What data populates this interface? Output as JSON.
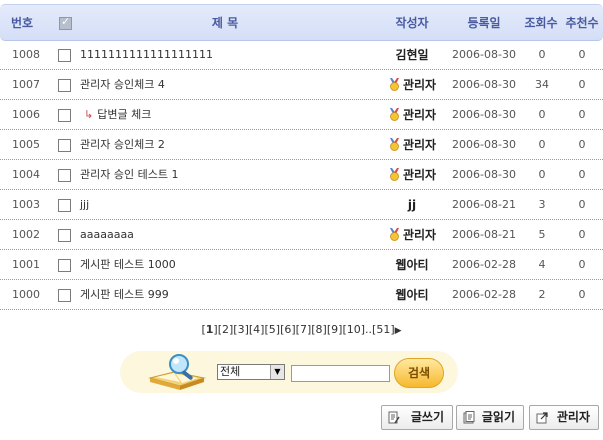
{
  "header": {
    "no": "번호",
    "title": "제 목",
    "writer": "작성자",
    "date": "등록일",
    "views": "조회수",
    "recommend": "추천수"
  },
  "rows": [
    {
      "no": "1008",
      "title": "1111111111111111111",
      "writer": "김현일",
      "admin": false,
      "date": "2006-08-30",
      "views": "0",
      "rec": "0",
      "reply": false
    },
    {
      "no": "1007",
      "title": "관리자 승인체크 4",
      "writer": "관리자",
      "admin": true,
      "date": "2006-08-30",
      "views": "34",
      "rec": "0",
      "reply": false
    },
    {
      "no": "1006",
      "title": "답변글 체크",
      "writer": "관리자",
      "admin": true,
      "date": "2006-08-30",
      "views": "0",
      "rec": "0",
      "reply": true
    },
    {
      "no": "1005",
      "title": "관리자 승인체크 2",
      "writer": "관리자",
      "admin": true,
      "date": "2006-08-30",
      "views": "0",
      "rec": "0",
      "reply": false
    },
    {
      "no": "1004",
      "title": "관리자 승인 테스트 1",
      "writer": "관리자",
      "admin": true,
      "date": "2006-08-30",
      "views": "0",
      "rec": "0",
      "reply": false
    },
    {
      "no": "1003",
      "title": "jjj",
      "writer": "jj",
      "admin": false,
      "date": "2006-08-21",
      "views": "3",
      "rec": "0",
      "reply": false
    },
    {
      "no": "1002",
      "title": "aaaaaaaa",
      "writer": "관리자",
      "admin": true,
      "date": "2006-08-21",
      "views": "5",
      "rec": "0",
      "reply": false
    },
    {
      "no": "1001",
      "title": "게시판 테스트 1000",
      "writer": "웹아티",
      "admin": false,
      "date": "2006-02-28",
      "views": "4",
      "rec": "0",
      "reply": false
    },
    {
      "no": "1000",
      "title": "게시판 테스트 999",
      "writer": "웹아티",
      "admin": false,
      "date": "2006-02-28",
      "views": "2",
      "rec": "0",
      "reply": false
    }
  ],
  "pagination": {
    "current": "1",
    "pages": [
      "2",
      "3",
      "4",
      "5",
      "6",
      "7",
      "8",
      "9",
      "10"
    ],
    "ellipsis": "..",
    "last": "51"
  },
  "search": {
    "scope_selected": "전체",
    "query": "",
    "button_label": "검색"
  },
  "buttons": {
    "write": "글쓰기",
    "read": "글읽기",
    "admin": "관리자"
  },
  "colors": {
    "header_bg": "#d9e2f8",
    "header_text": "#4a5aa0",
    "search_bg": "#fdf7de",
    "search_button": "#f7b82f",
    "reply_arrow": "#d24a4a"
  },
  "icons": {
    "admin_badge": "medal-icon",
    "reply": "reply-arrow-icon",
    "next": "triangle-right-icon"
  }
}
